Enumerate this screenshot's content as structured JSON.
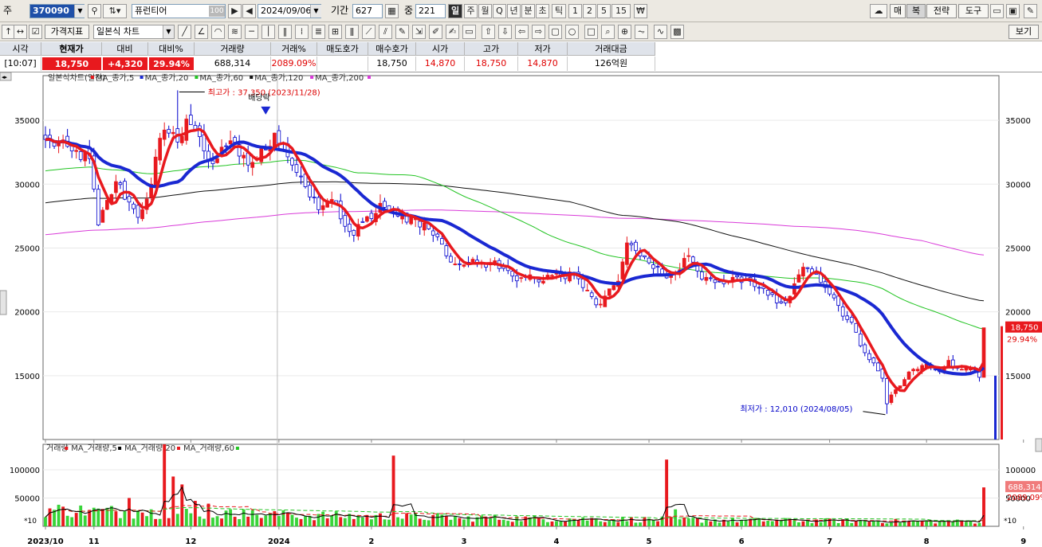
{
  "toolbar": {
    "type_label": "주",
    "code": "370090",
    "name": "퓨런티어",
    "name_badge": "100",
    "date": "2024/09/06",
    "period_label": "기간",
    "period": "627",
    "count_label": "중",
    "count": "221",
    "periods": [
      "일",
      "주",
      "월",
      "Q",
      "년",
      "분",
      "초",
      "틱",
      "1",
      "2",
      "5",
      "15"
    ],
    "right_buttons": [
      "매",
      "복",
      "전략",
      "도구"
    ],
    "indicator_btn": "가격지표",
    "chart_type": "일본식 차트",
    "view_btn": "보기"
  },
  "quote": {
    "headers": [
      "시각",
      "현재가",
      "대비",
      "대비%",
      "거래량",
      "거래%",
      "매도호가",
      "매수호가",
      "시가",
      "고가",
      "저가",
      "거래대금"
    ],
    "values": [
      "[10:07]",
      "18,750",
      "+4,320",
      "29.94%",
      "688,314",
      "2089.09%",
      "",
      "18,750",
      "14,870",
      "18,750",
      "14,870",
      "126억원"
    ]
  },
  "chart_data": {
    "type": "candlestick",
    "legend": [
      "일본식차트(일간)",
      "MA_종가,5",
      "MA_종가,20",
      "MA_종가,60",
      "MA_종가,120",
      "MA_종가,200"
    ],
    "ylim": [
      10000,
      38500
    ],
    "yticks": [
      15000,
      20000,
      25000,
      30000,
      35000
    ],
    "ytick_labels": [
      "15000",
      "20000",
      "25000",
      "30000",
      "35000"
    ],
    "xlabels": [
      {
        "label": "2023/10",
        "i": 0
      },
      {
        "label": "11",
        "i": 11
      },
      {
        "label": "12",
        "i": 33
      },
      {
        "label": "2024",
        "i": 53
      },
      {
        "label": "2",
        "i": 74
      },
      {
        "label": "3",
        "i": 95
      },
      {
        "label": "4",
        "i": 116
      },
      {
        "label": "5",
        "i": 137
      },
      {
        "label": "6",
        "i": 158
      },
      {
        "label": "7",
        "i": 178
      },
      {
        "label": "8",
        "i": 200
      },
      {
        "label": "9",
        "i": 222
      }
    ],
    "price_anchors": [
      [
        0,
        33500
      ],
      [
        6,
        32600
      ],
      [
        10,
        32000
      ],
      [
        12,
        26800
      ],
      [
        16,
        30200
      ],
      [
        19,
        28600
      ],
      [
        21,
        27400
      ],
      [
        24,
        30000
      ],
      [
        26,
        33600
      ],
      [
        28,
        34000
      ],
      [
        30,
        33300
      ],
      [
        32,
        35100
      ],
      [
        34,
        34300
      ],
      [
        36,
        32600
      ],
      [
        38,
        31600
      ],
      [
        40,
        32900
      ],
      [
        42,
        33400
      ],
      [
        44,
        32200
      ],
      [
        46,
        31500
      ],
      [
        50,
        32700
      ],
      [
        52,
        34000
      ],
      [
        54,
        33200
      ],
      [
        56,
        31500
      ],
      [
        58,
        30600
      ],
      [
        60,
        29000
      ],
      [
        62,
        28000
      ],
      [
        64,
        28700
      ],
      [
        66,
        28400
      ],
      [
        68,
        26700
      ],
      [
        70,
        26000
      ],
      [
        72,
        27000
      ],
      [
        74,
        27300
      ],
      [
        76,
        28500
      ],
      [
        78,
        27800
      ],
      [
        80,
        27500
      ],
      [
        84,
        27300
      ],
      [
        87,
        26500
      ],
      [
        90,
        25300
      ],
      [
        92,
        23900
      ],
      [
        96,
        23700
      ],
      [
        98,
        23800
      ],
      [
        102,
        24000
      ],
      [
        104,
        23400
      ],
      [
        106,
        22800
      ],
      [
        110,
        22900
      ],
      [
        113,
        22400
      ],
      [
        116,
        23100
      ],
      [
        118,
        22600
      ],
      [
        120,
        23100
      ],
      [
        122,
        21900
      ],
      [
        124,
        21200
      ],
      [
        126,
        20600
      ],
      [
        128,
        21800
      ],
      [
        130,
        22400
      ],
      [
        132,
        25400
      ],
      [
        134,
        24800
      ],
      [
        136,
        24300
      ],
      [
        138,
        23400
      ],
      [
        140,
        22900
      ],
      [
        142,
        22900
      ],
      [
        144,
        23300
      ],
      [
        146,
        24400
      ],
      [
        148,
        23200
      ],
      [
        150,
        22700
      ],
      [
        152,
        22300
      ],
      [
        154,
        22200
      ],
      [
        156,
        22700
      ],
      [
        158,
        22300
      ],
      [
        160,
        22400
      ],
      [
        162,
        21900
      ],
      [
        164,
        21300
      ],
      [
        166,
        20700
      ],
      [
        168,
        20700
      ],
      [
        170,
        22200
      ],
      [
        172,
        23500
      ],
      [
        174,
        23000
      ],
      [
        176,
        22300
      ],
      [
        178,
        21400
      ],
      [
        180,
        20500
      ],
      [
        182,
        19400
      ],
      [
        184,
        18400
      ],
      [
        186,
        16800
      ],
      [
        188,
        16000
      ],
      [
        190,
        14800
      ],
      [
        191,
        12800
      ],
      [
        193,
        13900
      ],
      [
        195,
        14700
      ],
      [
        197,
        15500
      ],
      [
        199,
        15800
      ],
      [
        201,
        15700
      ],
      [
        203,
        15300
      ],
      [
        205,
        16200
      ],
      [
        207,
        15600
      ],
      [
        209,
        15600
      ],
      [
        211,
        15500
      ],
      [
        212,
        14870
      ],
      [
        213,
        18750
      ]
    ],
    "candle_count": 214,
    "annotations": {
      "high": {
        "label": "최고가 : 37,350 (2023/11/28)",
        "value": 37350,
        "i": 30
      },
      "low": {
        "label": "최저가 : 12,010 (2024/08/05)",
        "value": 12010,
        "i": 191
      },
      "dividend": {
        "label": "배당락",
        "i": 50
      }
    },
    "last_price_label": "18,750",
    "last_pct_label": "29.94%",
    "volume": {
      "legend": [
        "거래량",
        "MA_거래량,5",
        "MA_거래량,20",
        "MA_거래량,60"
      ],
      "ylim": [
        0,
        145000
      ],
      "yticks": [
        50000,
        100000
      ],
      "ytick_labels": [
        "50000",
        "100000"
      ],
      "axis_unit": "*10",
      "spikes": [
        [
          19,
          50000
        ],
        [
          21,
          28000
        ],
        [
          27,
          148000
        ],
        [
          29,
          88000
        ],
        [
          31,
          74000
        ],
        [
          34,
          45000
        ],
        [
          37,
          40000
        ],
        [
          45,
          30000
        ],
        [
          55,
          24000
        ],
        [
          79,
          125000
        ],
        [
          95,
          12000
        ],
        [
          119,
          14000
        ],
        [
          141,
          118000
        ],
        [
          143,
          30000
        ],
        [
          170,
          11000
        ],
        [
          175,
          12000
        ],
        [
          213,
          68800
        ]
      ],
      "last_label": "688,314",
      "last_pct": "2089.09%"
    },
    "colors": {
      "up": "#e8191e",
      "down": "#0000cc",
      "ma5": "#e8191e",
      "ma20": "#1a28d2",
      "ma60": "#22c422",
      "ma120": "#111111",
      "ma200": "#d93ad9"
    }
  }
}
